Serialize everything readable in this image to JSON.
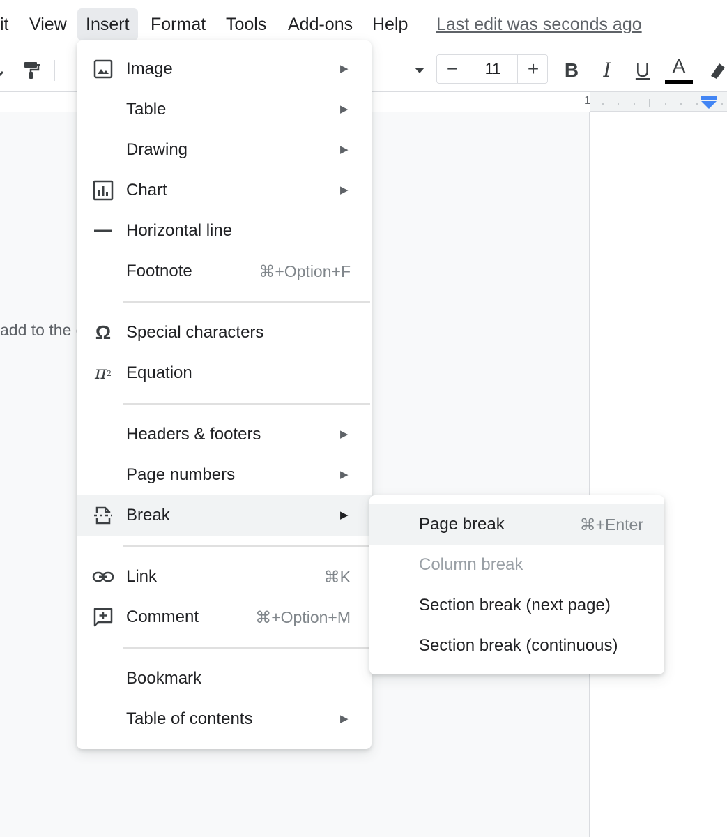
{
  "menubar": {
    "items": [
      "it",
      "View",
      "Insert",
      "Format",
      "Tools",
      "Add-ons",
      "Help"
    ],
    "active": "Insert",
    "last_edit": "Last edit was seconds ago"
  },
  "toolbar": {
    "font_size": "11",
    "decrease_label": "−",
    "increase_label": "+",
    "bold": "B",
    "italic": "I",
    "underline": "U",
    "text_color": "A",
    "text_color_value": "#000000"
  },
  "ruler": {
    "marker": "1"
  },
  "document": {
    "visible_text": "add to the d"
  },
  "insert_menu": {
    "items": [
      {
        "label": "Image",
        "icon": "image-icon",
        "submenu": true
      },
      {
        "label": "Table",
        "submenu": true
      },
      {
        "label": "Drawing",
        "submenu": true
      },
      {
        "label": "Chart",
        "icon": "chart-icon",
        "submenu": true
      },
      {
        "label": "Horizontal line",
        "icon": "horizontal-line-icon"
      },
      {
        "label": "Footnote",
        "shortcut": "⌘+Option+F"
      },
      {
        "label": "Special characters",
        "icon": "omega-icon"
      },
      {
        "label": "Equation",
        "icon": "pi-icon"
      },
      {
        "label": "Headers & footers",
        "submenu": true
      },
      {
        "label": "Page numbers",
        "submenu": true
      },
      {
        "label": "Break",
        "icon": "break-icon",
        "submenu": true,
        "highlighted": true
      },
      {
        "label": "Link",
        "icon": "link-icon",
        "shortcut": "⌘K"
      },
      {
        "label": "Comment",
        "icon": "comment-icon",
        "shortcut": "⌘+Option+M"
      },
      {
        "label": "Bookmark"
      },
      {
        "label": "Table of contents",
        "submenu": true
      }
    ],
    "arrow": "▶"
  },
  "break_submenu": {
    "items": [
      {
        "label": "Page break",
        "shortcut": "⌘+Enter",
        "highlighted": true
      },
      {
        "label": "Column break",
        "disabled": true
      },
      {
        "label": "Section break (next page)"
      },
      {
        "label": "Section break (continuous)"
      }
    ]
  },
  "colors": {
    "accent_blue": "#4285f4",
    "menu_highlight": "#f1f3f4",
    "text_primary": "#202124",
    "text_disabled": "#9aa0a6"
  }
}
